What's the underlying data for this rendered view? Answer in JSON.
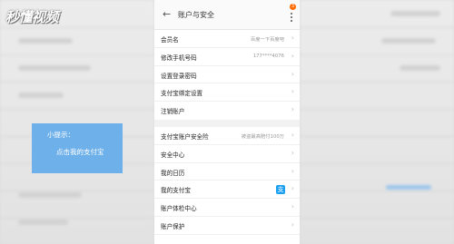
{
  "watermark": {
    "logo_text": "秒懂视频"
  },
  "tip": {
    "title": "小提示：",
    "text": "点击我的支付宝"
  },
  "header": {
    "title": "账户与安全",
    "badge": "3"
  },
  "section1": [
    {
      "label": "会员名",
      "value": "百度一下百度吧"
    },
    {
      "label": "修改手机号码",
      "value": "177****4076"
    },
    {
      "label": "设置登录密码",
      "value": ""
    },
    {
      "label": "支付宝绑定设置",
      "value": ""
    },
    {
      "label": "注销账户",
      "value": ""
    }
  ],
  "section2": [
    {
      "label": "支付宝账户安全险",
      "value": "被盗最高赔付100万"
    },
    {
      "label": "安全中心",
      "value": ""
    },
    {
      "label": "我的日历",
      "value": ""
    },
    {
      "label": "我的支付宝",
      "value": "",
      "icon": "alipay-icon"
    },
    {
      "label": "账户体检中心",
      "value": ""
    },
    {
      "label": "账户保护",
      "value": ""
    }
  ],
  "colors": {
    "tip_bg": "#6eb0ea",
    "alipay": "#1a9ef0",
    "badge": "#ff6a00"
  }
}
